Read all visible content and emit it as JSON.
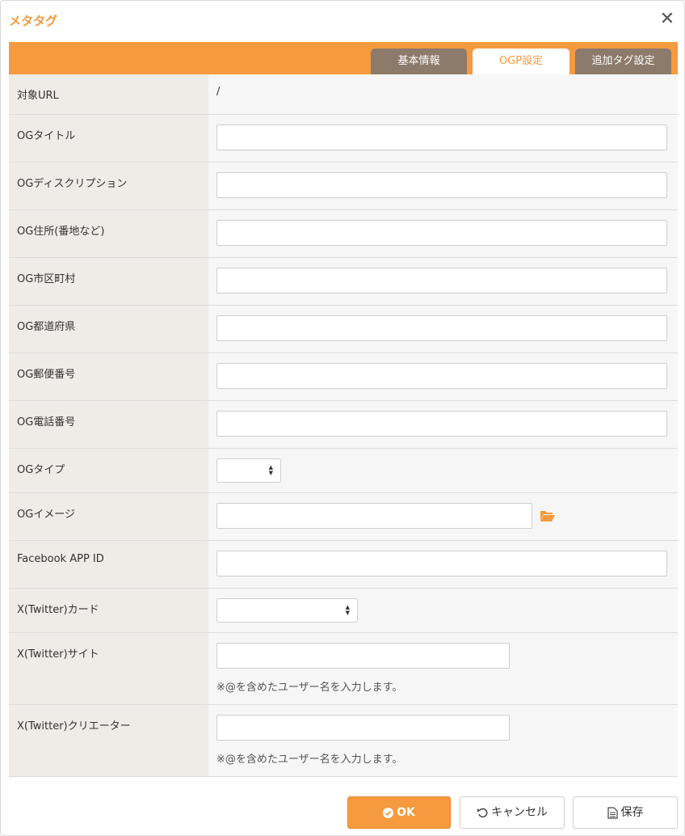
{
  "dialog": {
    "title": "メタタグ",
    "close_symbol": "✕"
  },
  "tabs": [
    {
      "label": "基本情報",
      "active": false
    },
    {
      "label": "OGP設定",
      "active": true
    },
    {
      "label": "追加タグ設定",
      "active": false
    }
  ],
  "form": {
    "target_url": {
      "label": "対象URL",
      "value": "/"
    },
    "og_title": {
      "label": "OGタイトル",
      "value": ""
    },
    "og_description": {
      "label": "OGディスクリプション",
      "value": ""
    },
    "og_address": {
      "label": "OG住所(番地など)",
      "value": ""
    },
    "og_city": {
      "label": "OG市区町村",
      "value": ""
    },
    "og_prefecture": {
      "label": "OG都道府県",
      "value": ""
    },
    "og_postal": {
      "label": "OG郵便番号",
      "value": ""
    },
    "og_phone": {
      "label": "OG電話番号",
      "value": ""
    },
    "og_type": {
      "label": "OGタイプ",
      "selected": ""
    },
    "og_image": {
      "label": "OGイメージ",
      "value": "",
      "icon": "folder-open-icon"
    },
    "fb_app_id": {
      "label": "Facebook APP ID",
      "value": ""
    },
    "twitter_card": {
      "label": "X(Twitter)カード",
      "selected": ""
    },
    "twitter_site": {
      "label": "X(Twitter)サイト",
      "value": "",
      "note": "※@を含めたユーザー名を入力します。"
    },
    "twitter_creator": {
      "label": "X(Twitter)クリエーター",
      "value": "",
      "note": "※@を含めたユーザー名を入力します。"
    }
  },
  "footer": {
    "ok_label": "OK",
    "cancel_label": "キャンセル",
    "save_label": "保存"
  },
  "colors": {
    "accent": "#f59a3f",
    "tab_inactive": "#8c7b6b",
    "label_bg": "#efebe6"
  }
}
